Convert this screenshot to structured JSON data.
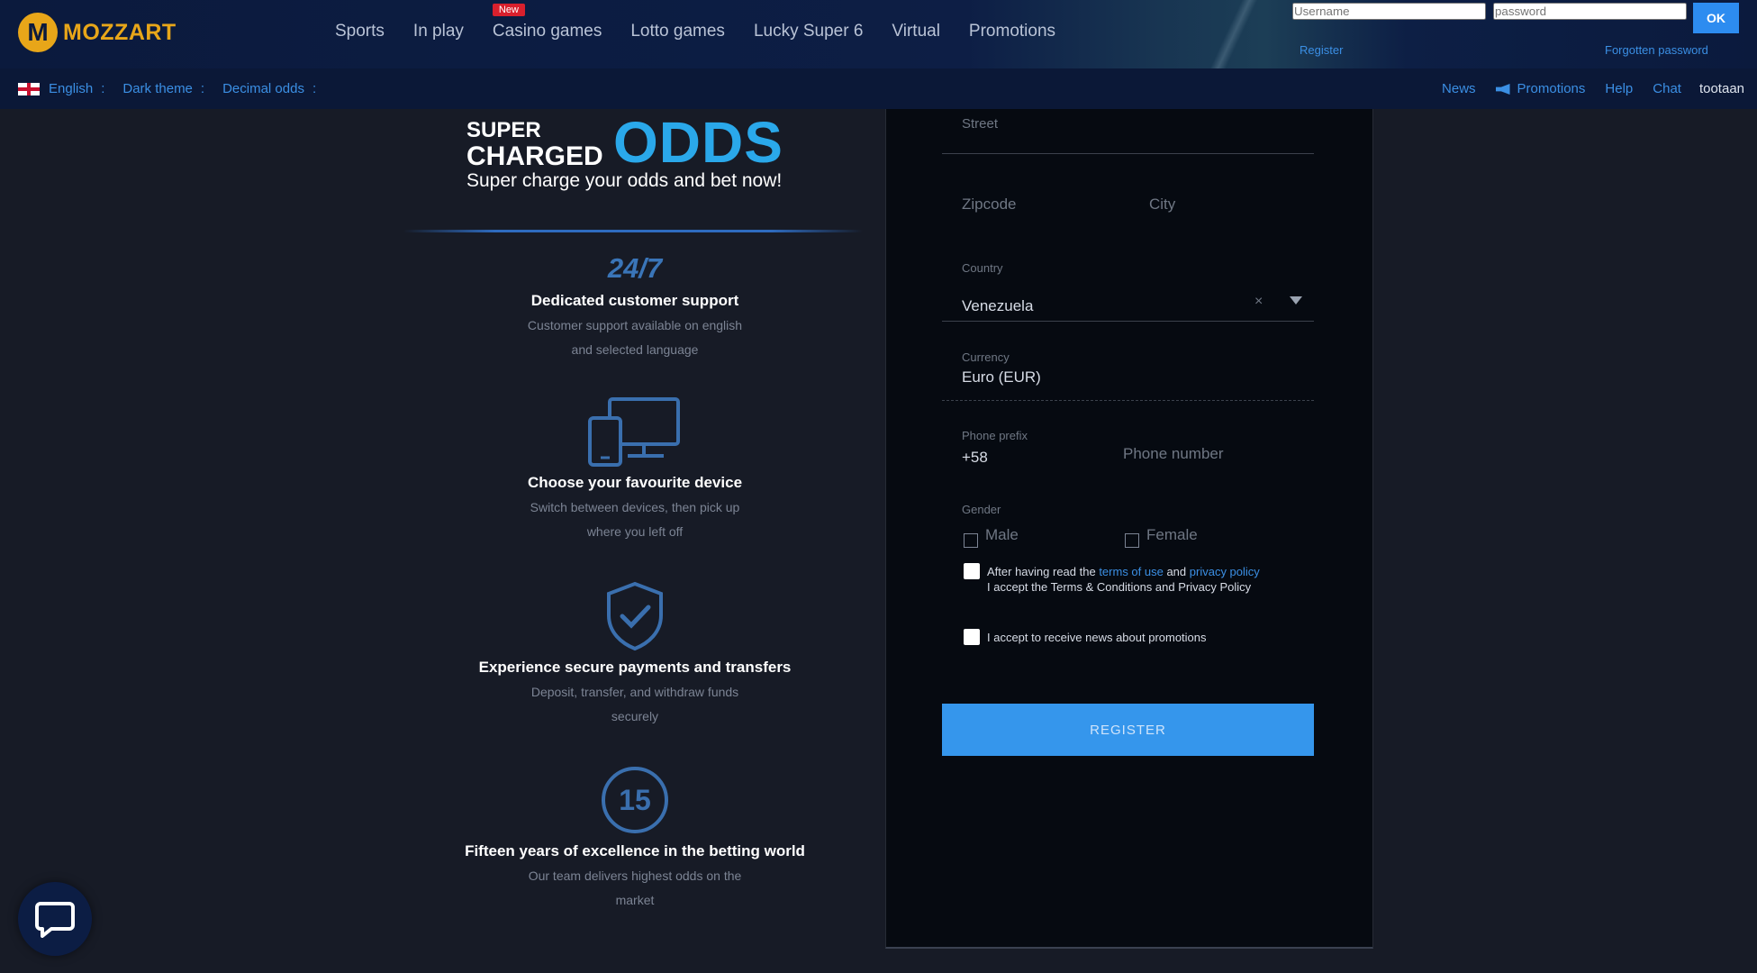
{
  "brand": {
    "logo_letter": "M",
    "name": "MOZZART"
  },
  "main_nav": [
    {
      "label": "Sports"
    },
    {
      "label": "In play"
    },
    {
      "label": "Casino games",
      "badge": "New"
    },
    {
      "label": "Lotto games"
    },
    {
      "label": "Lucky Super 6"
    },
    {
      "label": "Virtual"
    },
    {
      "label": "Promotions"
    }
  ],
  "login": {
    "username_placeholder": "Username",
    "password_placeholder": "password",
    "ok_label": "OK",
    "register_link": "Register",
    "forgot_link": "Forgotten password"
  },
  "subbar": {
    "language": "English",
    "theme": "Dark theme",
    "odds_format": "Decimal odds",
    "separator": ":",
    "right_links": [
      "News",
      "Promotions",
      "Help",
      "Chat"
    ],
    "user": "tootaan"
  },
  "promo": {
    "super": "SUPER",
    "charged": "CHARGED",
    "odds": "ODDS",
    "tagline": "Super charge your odds and bet now!"
  },
  "features": [
    {
      "badge": "24/7",
      "title": "Dedicated customer support",
      "desc_1": "Customer support available on english",
      "desc_2": "and selected language",
      "icon": "clock-247-icon"
    },
    {
      "title": "Choose your favourite device",
      "desc_1": "Switch between devices, then pick up",
      "desc_2": "where you left off",
      "icon": "devices-icon"
    },
    {
      "title": "Experience secure payments and transfers",
      "desc_1": "Deposit, transfer, and withdraw funds",
      "desc_2": "securely",
      "icon": "shield-check-icon"
    },
    {
      "badge": "15",
      "title": "Fifteen years of excellence in the betting world",
      "desc_1": "Our team delivers highest odds on the",
      "desc_2": "market",
      "icon": "fifteen-years-icon"
    }
  ],
  "form": {
    "street_placeholder": "Street",
    "zipcode_placeholder": "Zipcode",
    "city_placeholder": "City",
    "country_label": "Country",
    "country_value": "Venezuela",
    "currency_label": "Currency",
    "currency_value": "Euro (EUR)",
    "phone_prefix_label": "Phone prefix",
    "phone_prefix_value": "+58",
    "phone_number_placeholder": "Phone number",
    "gender_label": "Gender",
    "gender_male": "Male",
    "gender_female": "Female",
    "terms_prefix": "After having read the ",
    "terms_link": "terms of use",
    "terms_and": " and ",
    "privacy_link": "privacy policy",
    "terms_line2": "I accept the Terms & Conditions and Privacy Policy",
    "newsletter": "I accept to receive news about promotions",
    "register_button": "REGISTER"
  },
  "colors": {
    "accent": "#3596ec",
    "brand_gold": "#e8a619",
    "odds_blue": "#2aa8ea",
    "badge_red": "#d9202d"
  }
}
